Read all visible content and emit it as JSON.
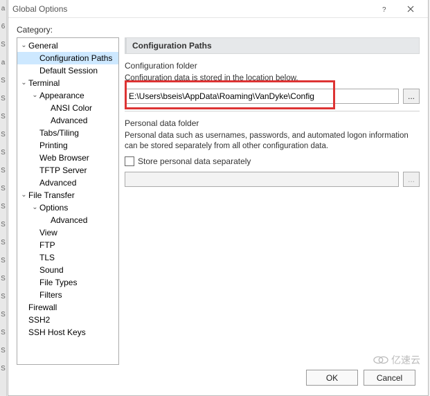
{
  "window": {
    "title": "Global Options"
  },
  "category_label": "Category:",
  "tree": [
    {
      "label": "General",
      "depth": 0,
      "exp": true,
      "hasChildren": true
    },
    {
      "label": "Configuration Paths",
      "depth": 1,
      "selected": true
    },
    {
      "label": "Default Session",
      "depth": 1
    },
    {
      "label": "Terminal",
      "depth": 0,
      "exp": true,
      "hasChildren": true
    },
    {
      "label": "Appearance",
      "depth": 1,
      "exp": true,
      "hasChildren": true
    },
    {
      "label": "ANSI Color",
      "depth": 2
    },
    {
      "label": "Advanced",
      "depth": 2
    },
    {
      "label": "Tabs/Tiling",
      "depth": 1
    },
    {
      "label": "Printing",
      "depth": 1
    },
    {
      "label": "Web Browser",
      "depth": 1
    },
    {
      "label": "TFTP Server",
      "depth": 1
    },
    {
      "label": "Advanced",
      "depth": 1
    },
    {
      "label": "File Transfer",
      "depth": 0,
      "exp": true,
      "hasChildren": true
    },
    {
      "label": "Options",
      "depth": 1,
      "exp": true,
      "hasChildren": true
    },
    {
      "label": "Advanced",
      "depth": 2
    },
    {
      "label": "View",
      "depth": 1
    },
    {
      "label": "FTP",
      "depth": 1
    },
    {
      "label": "TLS",
      "depth": 1
    },
    {
      "label": "Sound",
      "depth": 1
    },
    {
      "label": "File Types",
      "depth": 1
    },
    {
      "label": "Filters",
      "depth": 1
    },
    {
      "label": "Firewall",
      "depth": 0
    },
    {
      "label": "SSH2",
      "depth": 0
    },
    {
      "label": "SSH Host Keys",
      "depth": 0
    }
  ],
  "panel": {
    "title": "Configuration Paths",
    "config_section": {
      "title": "Configuration folder",
      "desc": "Configuration data is stored in the location below.",
      "path": "E:\\Users\\bseis\\AppData\\Roaming\\VanDyke\\Config",
      "browse": "..."
    },
    "personal_section": {
      "title": "Personal data folder",
      "desc": "Personal data such as usernames, passwords, and automated logon information can be stored separately from all other configuration data.",
      "checkbox_label": "Store personal data separately",
      "path": "",
      "browse": "..."
    }
  },
  "buttons": {
    "ok": "OK",
    "cancel": "Cancel"
  },
  "watermark": "亿速云"
}
